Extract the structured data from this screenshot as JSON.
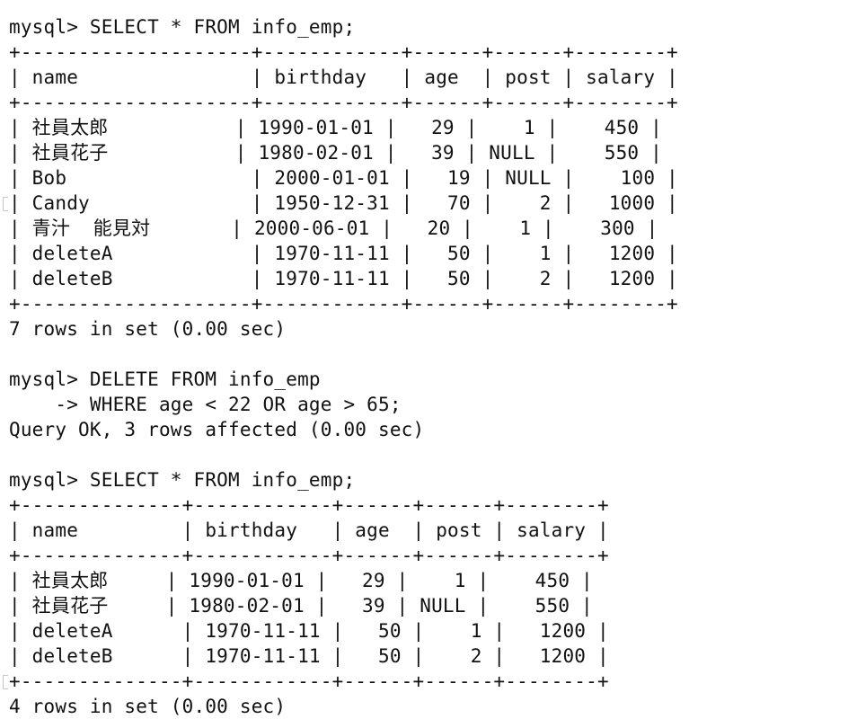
{
  "terminal": {
    "blocks": [
      {
        "type": "command",
        "lines": [
          "mysql> SELECT * FROM info_emp;"
        ]
      },
      {
        "type": "table",
        "lines": [
          "+--------------------+------------+------+------+--------+",
          "| name               | birthday   | age  | post | salary |",
          "+--------------------+------------+------+------+--------+",
          "| 社員太郎           | 1990-01-01 |   29 |    1 |    450 |",
          "| 社員花子           | 1980-02-01 |   39 | NULL |    550 |",
          "| Bob                | 2000-01-01 |   19 | NULL |    100 |",
          "| Candy              | 1950-12-31 |   70 |    2 |   1000 |",
          "| 青汁  能見対       | 2000-06-01 |   20 |    1 |    300 |",
          "| deleteA            | 1970-11-11 |   50 |    1 |   1200 |",
          "| deleteB            | 1970-11-11 |   50 |    2 |   1200 |",
          "+--------------------+------------+------+------+--------+"
        ]
      },
      {
        "type": "output",
        "lines": [
          "7 rows in set (0.00 sec)"
        ]
      },
      {
        "type": "blank"
      },
      {
        "type": "command",
        "lines": [
          "mysql> DELETE FROM info_emp",
          "    -> WHERE age < 22 OR age > 65;"
        ]
      },
      {
        "type": "output",
        "lines": [
          "Query OK, 3 rows affected (0.00 sec)"
        ]
      },
      {
        "type": "blank"
      },
      {
        "type": "command",
        "lines": [
          "mysql> SELECT * FROM info_emp;"
        ]
      },
      {
        "type": "table",
        "lines": [
          "+--------------+------------+------+------+--------+",
          "| name         | birthday   | age  | post | salary |",
          "+--------------+------------+------+------+--------+",
          "| 社員太郎     | 1990-01-01 |   29 |    1 |    450 |",
          "| 社員花子     | 1980-02-01 |   39 | NULL |    550 |",
          "| deleteA      | 1970-11-11 |   50 |    1 |   1200 |",
          "| deleteB      | 1970-11-11 |   50 |    2 |   1200 |",
          "+--------------+------------+------+------+--------+"
        ]
      },
      {
        "type": "output",
        "lines": [
          "4 rows in set (0.00 sec)"
        ]
      }
    ]
  }
}
